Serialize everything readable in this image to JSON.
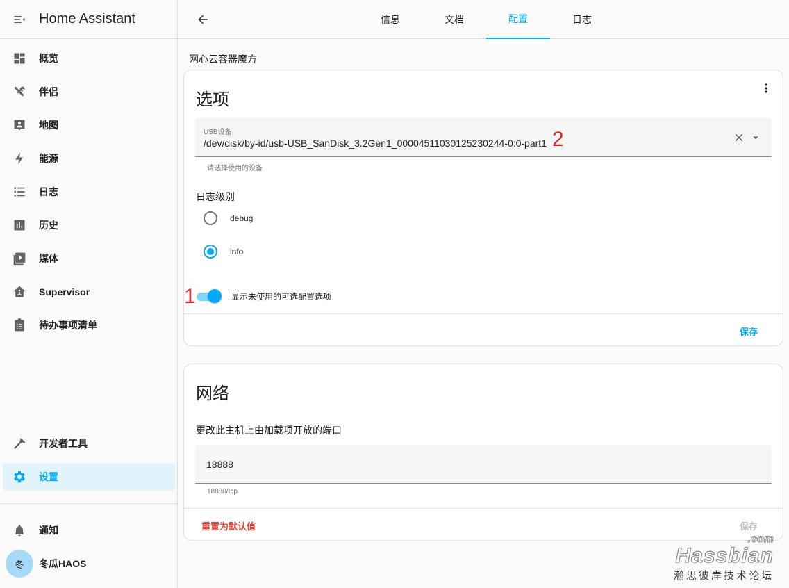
{
  "app": {
    "title": "Home Assistant"
  },
  "sidebar": {
    "items": [
      {
        "label": "概览",
        "icon": "dashboard-icon"
      },
      {
        "label": "伴侣",
        "icon": "tools-icon"
      },
      {
        "label": "地图",
        "icon": "map-icon"
      },
      {
        "label": "能源",
        "icon": "lightning-icon"
      },
      {
        "label": "日志",
        "icon": "logbook-icon"
      },
      {
        "label": "历史",
        "icon": "history-icon"
      },
      {
        "label": "媒体",
        "icon": "media-icon"
      },
      {
        "label": "Supervisor",
        "icon": "supervisor-icon"
      },
      {
        "label": "待办事项清单",
        "icon": "todo-icon"
      }
    ],
    "bottom_items": [
      {
        "label": "开发者工具",
        "icon": "hammer-icon"
      },
      {
        "label": "设置",
        "icon": "gear-icon",
        "active": true
      }
    ],
    "notifications_label": "通知",
    "user": {
      "initial": "冬",
      "name": "冬瓜HAOS"
    }
  },
  "tabs": [
    {
      "label": "信息"
    },
    {
      "label": "文档"
    },
    {
      "label": "配置",
      "active": true
    },
    {
      "label": "日志"
    }
  ],
  "addon_name": "网心云容器魔方",
  "options_card": {
    "title": "选项",
    "usb_field": {
      "label": "USB设备",
      "value": "/dev/disk/by-id/usb-USB_SanDisk_3.2Gen1_00004511030125230244-0:0-part1",
      "helper": "请选择使用的设备"
    },
    "log_level": {
      "label": "日志级别",
      "options": [
        "debug",
        "info"
      ],
      "selected": "info"
    },
    "toggle": {
      "label": "显示未使用的可选配置选项",
      "on": true
    },
    "save_label": "保存"
  },
  "network_card": {
    "title": "网络",
    "description": "更改此主机上由加载项开放的端口",
    "port_value": "18888",
    "port_helper": "18888/tcp",
    "reset_label": "重置为默认值",
    "save_label": "保存"
  },
  "annotations": {
    "first": "1",
    "second": "2"
  },
  "watermark": {
    "com": ".com",
    "main": "Hassbian",
    "sub": "瀚思彼岸技术论坛"
  },
  "colors": {
    "accent": "#03a9f4",
    "danger": "#db4437",
    "annotation": "#e3282a"
  }
}
